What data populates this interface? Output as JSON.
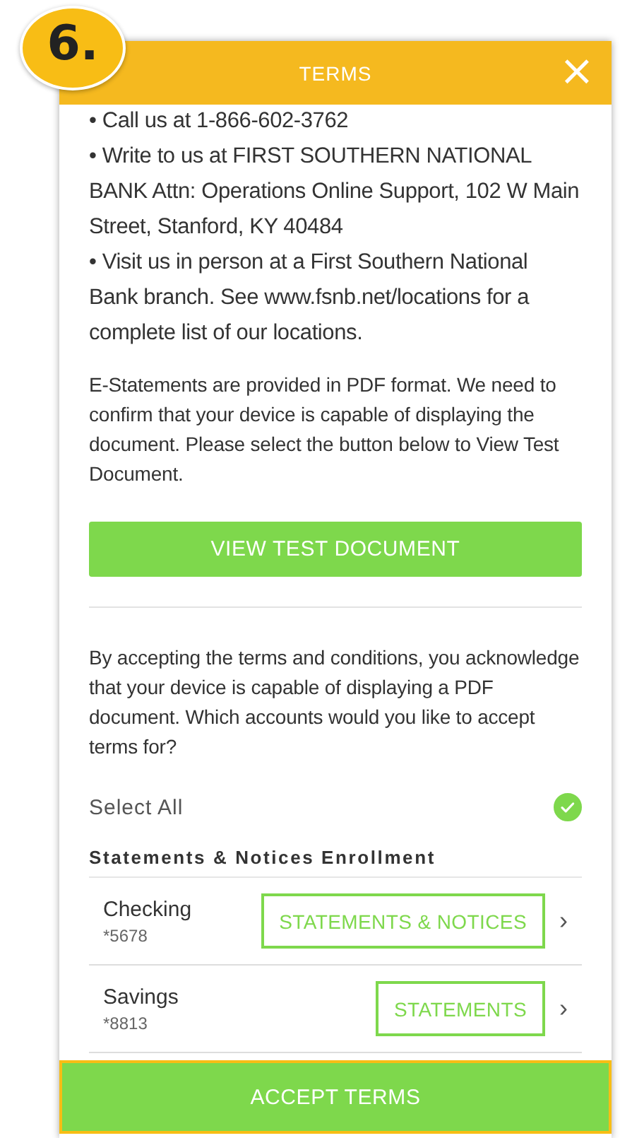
{
  "step_badge": "6.",
  "dialog": {
    "title": "TERMS",
    "close": "×"
  },
  "contact_lines": [
    "• Call us at 1-866-602-3762",
    "• Write to us at FIRST SOUTHERN NATIONAL BANK Attn: Operations Online Support, 102 W Main Street, Stanford, KY 40484",
    "• Visit us in person at a First Southern National Bank branch. See www.fsnb.net/locations for a complete list of our locations."
  ],
  "pdf_notice": "E-Statements are provided in PDF format. We need to confirm that your device is capable of displaying the document. Please select the button below to View Test Document.",
  "view_button": "VIEW TEST DOCUMENT",
  "accept_notice": "By accepting the terms and conditions, you acknowledge that your device is capable of displaying a PDF document. Which accounts would you like to accept terms for?",
  "select_all": {
    "label": "Select All",
    "checked": true
  },
  "section_title": "Statements & Notices Enrollment",
  "accounts": [
    {
      "name": "Checking",
      "number": "*5678",
      "option": "STATEMENTS & NOTICES",
      "chevron": "›"
    },
    {
      "name": "Savings",
      "number": "*8813",
      "option": "STATEMENTS",
      "chevron": "›"
    }
  ],
  "accept_button": "ACCEPT TERMS"
}
